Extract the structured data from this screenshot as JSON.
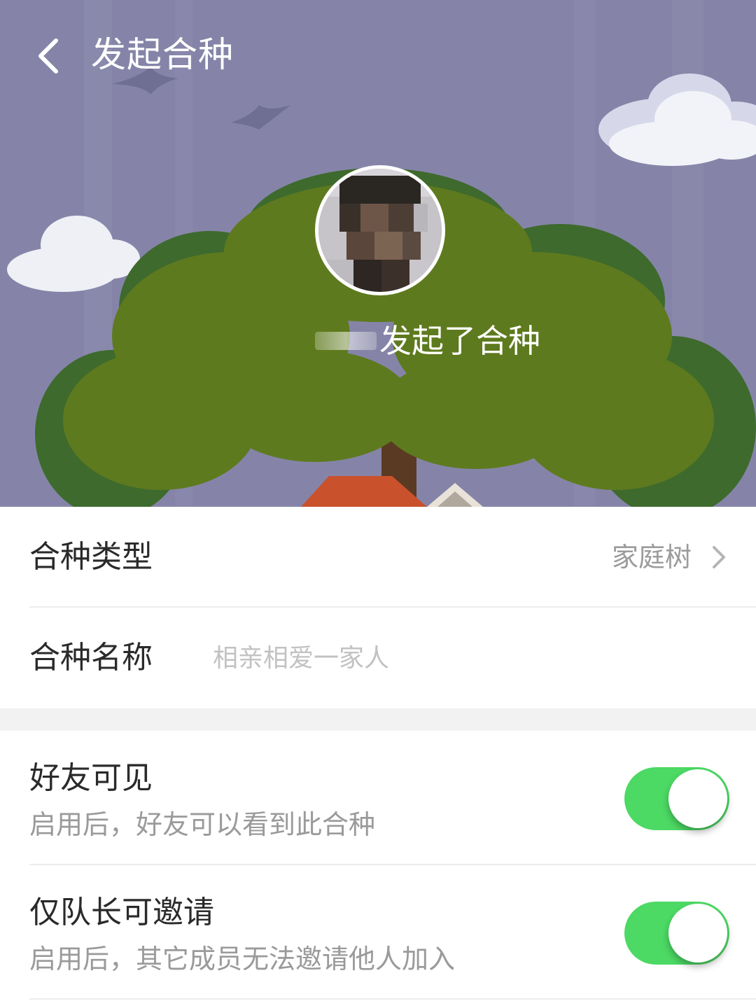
{
  "header": {
    "title": "发起合种",
    "back_icon": "chevron-left-icon"
  },
  "hero": {
    "initiator_text": "发起了合种",
    "colors": {
      "sky": "#8584a8",
      "tree_light": "#5f7a1d",
      "tree_dark": "#3d6b2c",
      "roof": "#c9512c"
    }
  },
  "form": {
    "type_row": {
      "label": "合种类型",
      "value": "家庭树",
      "icon": "chevron-right-icon"
    },
    "name_row": {
      "label": "合种名称",
      "placeholder": "相亲相爱一家人"
    },
    "toggles": [
      {
        "title": "好友可见",
        "description": "启用后，好友可以看到此合种",
        "on": true
      },
      {
        "title": "仅队长可邀请",
        "description": "启用后，其它成员无法邀请他人加入",
        "on": true
      }
    ],
    "switch_color": "#4cd964"
  }
}
